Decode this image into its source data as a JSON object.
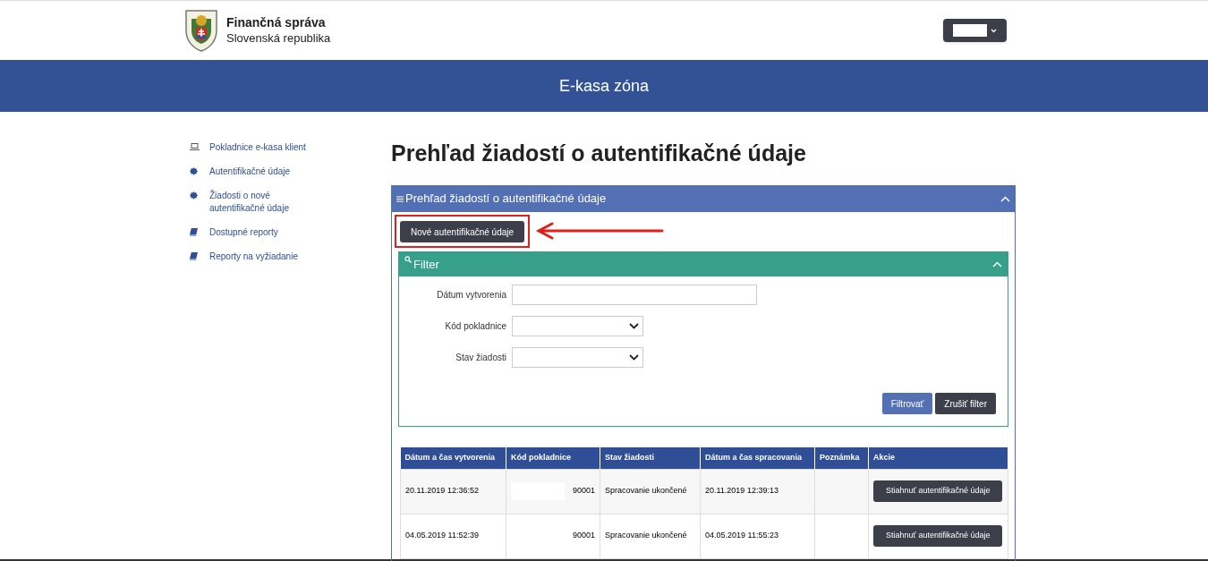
{
  "header": {
    "org_name": "Finančná správa",
    "org_country": "Slovenská republika"
  },
  "banner": {
    "title": "E-kasa zóna"
  },
  "sidebar": {
    "items": [
      {
        "label": "Pokladnice e-kasa klient",
        "kind": "laptop"
      },
      {
        "label": "Autentifikačné údaje",
        "kind": "badge"
      },
      {
        "label": "Žiadosti o nové autentifikačné údaje",
        "kind": "badge"
      },
      {
        "label": "Dostupné reporty",
        "kind": "book"
      },
      {
        "label": "Reporty na vyžiadanie",
        "kind": "book"
      }
    ]
  },
  "page_title": "Prehľad žiadostí o autentifikačné údaje",
  "panel": {
    "title": "Prehľad žiadostí o autentifikačné údaje",
    "new_button": "Nové autentifikačné údaje",
    "filter": {
      "title": "Filter",
      "fields": [
        {
          "label": "Dátum vytvorenia",
          "kind": "text"
        },
        {
          "label": "Kód pokladnice",
          "kind": "select"
        },
        {
          "label": "Stav žiadosti",
          "kind": "select"
        }
      ],
      "buttons": [
        {
          "label": "Filtrovať",
          "kind": "primary"
        },
        {
          "label": "Zrušiť filter",
          "kind": "secondary"
        }
      ]
    },
    "table": {
      "columns": [
        "Dátum a čas vytvorenia",
        "Kód pokladnice",
        "Stav žiadosti",
        "Dátum a čas spracovania",
        "Poznámka",
        "Akcie"
      ],
      "rows": [
        {
          "created": "20.11.2019 12:36:52",
          "code": "90001",
          "status": "Spracovanie ukončené",
          "processed": "20.11.2019 12:39:13",
          "note": "",
          "action": "Stiahnuť autentifikačné údaje"
        },
        {
          "created": "04.05.2019 11:52:39",
          "code": "90001",
          "status": "Spracovanie ukončené",
          "processed": "04.05.2019 11:55:23",
          "note": "",
          "action": "Stiahnuť autentifikačné údaje"
        }
      ]
    }
  }
}
